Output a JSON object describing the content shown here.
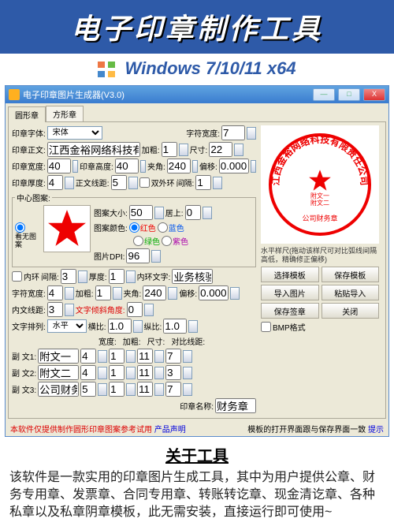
{
  "banner": {
    "title": "电子印章制作工具",
    "subtitle": "Windows 7/10/11 x64"
  },
  "window": {
    "title": "电子印章图片生成器(V3.0)",
    "min": "—",
    "max": "□",
    "close": "X"
  },
  "tabs": {
    "round": "圆形章",
    "square": "方形章"
  },
  "form": {
    "font_label": "印章字体:",
    "font": "宋体",
    "char_width_label": "字符宽度:",
    "char_width": "7",
    "main_text_label": "印章正文:",
    "main_text": "江西金裕网络科技有限责",
    "bold_label": "加粗:",
    "bold": "1",
    "size_label": "尺寸:",
    "size": "22",
    "seal_w_label": "印章宽度:",
    "seal_w": "40",
    "seal_h_label": "印章高度:",
    "seal_h": "40",
    "angle_label": "夹角:",
    "angle": "240",
    "offset_label": "偏移:",
    "offset": "0.000",
    "thick_label": "印章厚度:",
    "thick": "4",
    "lineh_label": "正文线距:",
    "lineh": "5",
    "double_outer": "双外环",
    "gap_label": "间隔:",
    "gap": "1",
    "center_group": "中心图案:",
    "center_opt": "看无图案",
    "pic_size_label": "图案大小:",
    "pic_size": "50",
    "above_label": "居上:",
    "above": "0",
    "color_label": "图案颜色:",
    "red": "红色",
    "blue": "蓝色",
    "green": "绿色",
    "purple": "紫色",
    "dpi_label": "图片DPI:",
    "dpi": "96",
    "inner_ring": "内环",
    "inner_gap_label": "间隔:",
    "inner_gap": "3",
    "inner_thick_label": "厚度:",
    "inner_thick": "1",
    "inner_text_label": "内环文字:",
    "inner_text": "业务核验",
    "char_w2_label": "字符宽度:",
    "char_w2": "4",
    "bold2_label": "加粗:",
    "bold2": "1",
    "angle2_label": "夹角:",
    "angle2": "240",
    "offset2_label": "偏移:",
    "offset2": "0.000",
    "inner_dist_label": "内文线距:",
    "inner_dist": "3",
    "tilt_label": "文字倾斜角度:",
    "tilt": "0",
    "text_layout_label": "文字排列:",
    "text_layout": "水平",
    "hratio_label": "横比:",
    "hratio": "1.0",
    "vratio_label": "纵比:",
    "vratio": "1.0",
    "sub_w_label": "宽度:",
    "sub_bold_label": "加粗:",
    "sub_size_label": "尺寸:",
    "sub_line_label": "对比线距:",
    "sub1": "副 文1:",
    "sub1_v": "附文一",
    "sub1_w": "4",
    "sub1_b": "1",
    "sub1_s": "11",
    "sub1_l": "7",
    "sub2": "副 文2:",
    "sub2_v": "附文二",
    "sub2_w": "4",
    "sub2_b": "1",
    "sub2_s": "11",
    "sub2_l": "3",
    "sub3": "副 文3:",
    "sub3_v": "公司财务章",
    "sub3_w": "5",
    "sub3_b": "1",
    "sub3_s": "11",
    "sub3_l": "7",
    "seal_name_label": "印章名称:",
    "seal_name": "财务章"
  },
  "right": {
    "scale_hint": "水平样尺(拖动该样尺可对比弧线间隔高低，精确修正偏移)",
    "btn_sel_tpl": "选择模板",
    "btn_save_tpl": "保存模板",
    "btn_import": "导入图片",
    "btn_seal": "粘贴导入",
    "btn_clear": "保存签章",
    "btn_close": "关闭",
    "bmp": "BMP格式"
  },
  "seal_preview": {
    "arc_text": "江西金裕网络科技有限责任公司",
    "mid1": "附文一",
    "mid2": "附文二",
    "bottom": "公司财务章"
  },
  "footer": {
    "warn": "本软件仅提供制作圆形印章图案参考试用",
    "link1": "产品声明",
    "tip": "模板的打开界面跟与保存界面一致",
    "link2": "提示"
  },
  "about": {
    "title": "关于工具",
    "body": "该软件是一款实用的印章图片生成工具，其中为用户提供公章、财务专用章、发票章、合同专用章、转账转讫章、现金清讫章、各种私章以及私章阴章模板，此无需安装，直接运行即可使用~"
  }
}
